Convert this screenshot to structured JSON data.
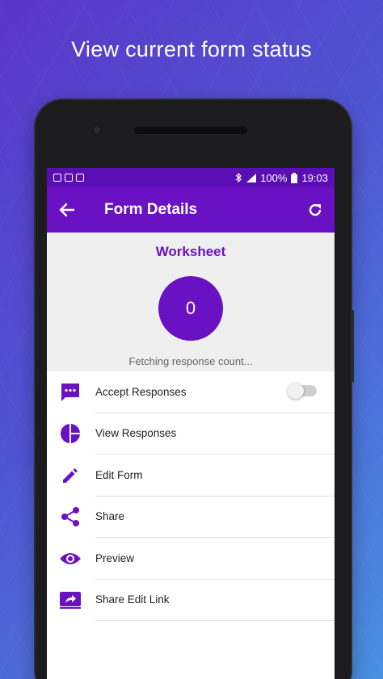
{
  "headline": "View current form status",
  "colors": {
    "accent": "#6a11c4",
    "statusbar": "#5b0eb3",
    "summary_bg": "#efefef"
  },
  "statusbar": {
    "battery": "100%",
    "time": "19:03"
  },
  "appbar": {
    "title": "Form Details",
    "back_icon": "arrow-left-icon",
    "refresh_icon": "refresh-icon"
  },
  "summary": {
    "form_name": "Worksheet",
    "response_count": "0",
    "status_text": "Fetching response count..."
  },
  "menu": [
    {
      "label": "Accept Responses",
      "icon": "chat-icon",
      "has_toggle": true,
      "toggle_on": false
    },
    {
      "label": "View Responses",
      "icon": "pie-chart-icon"
    },
    {
      "label": "Edit Form",
      "icon": "pencil-icon"
    },
    {
      "label": "Share",
      "icon": "share-icon"
    },
    {
      "label": "Preview",
      "icon": "eye-icon"
    },
    {
      "label": "Share Edit Link",
      "icon": "forward-link-icon"
    }
  ]
}
